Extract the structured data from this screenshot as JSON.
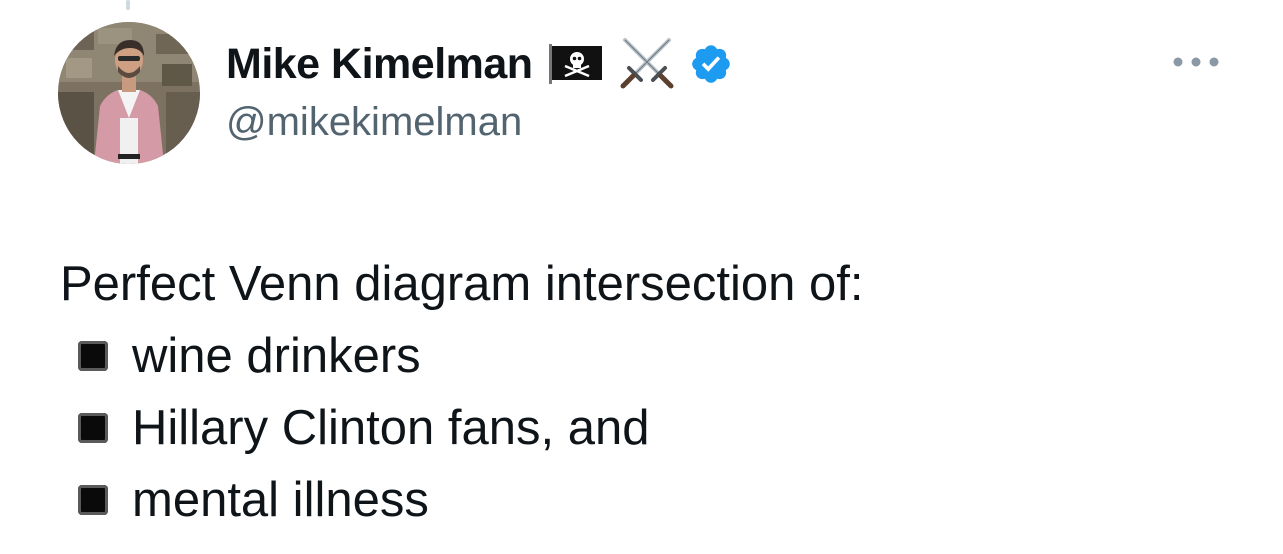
{
  "author": {
    "display_name": "Mike Kimelman",
    "handle": "@mikekimelman",
    "badges": [
      "pirate-flag-icon",
      "crossed-swords-icon",
      "verified-badge-icon"
    ],
    "verified_color": "#1d9bf0"
  },
  "tweet": {
    "intro": "Perfect Venn diagram intersection of:",
    "items": [
      "wine drinkers",
      "Hillary Clinton fans, and",
      "mental illness"
    ],
    "bullet_icon": "black-medium-square-icon"
  },
  "actions": {
    "more_icon": "more-options-icon"
  },
  "colors": {
    "text": "#0f1419",
    "secondary": "#536471",
    "thread_line": "#cfd9de"
  }
}
